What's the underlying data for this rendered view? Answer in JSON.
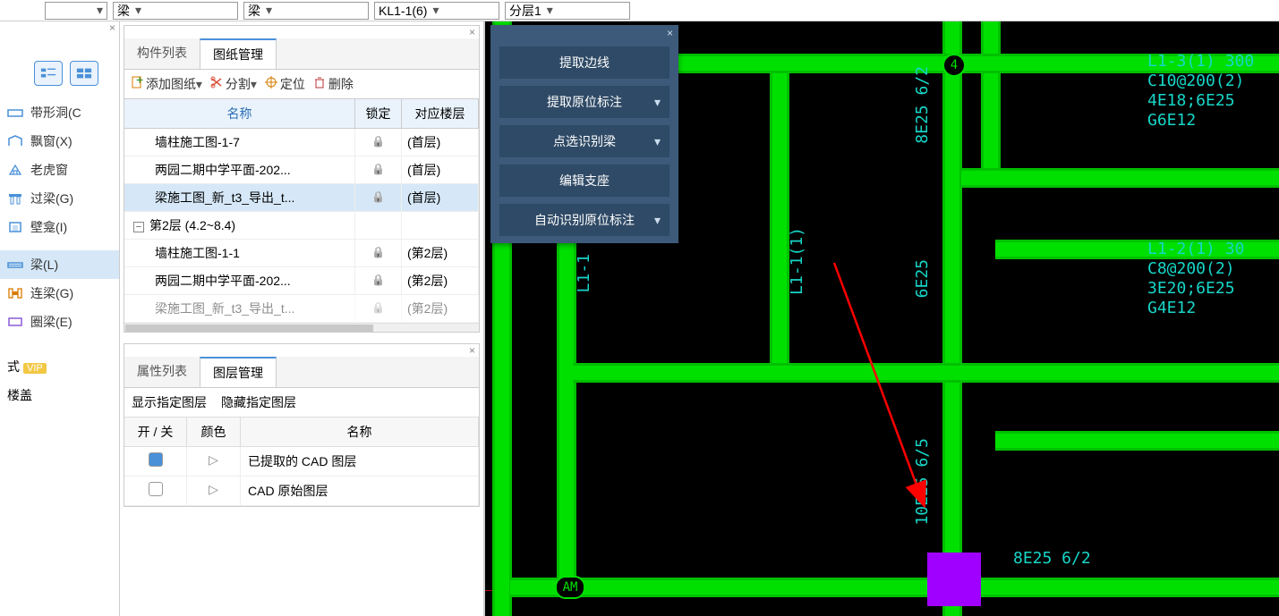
{
  "topbar": {
    "dd1": "",
    "dd2": "梁",
    "dd3": "梁",
    "dd4": "KL1-1(6)",
    "dd5": "分层1"
  },
  "left": {
    "items": [
      {
        "icon": "strip-hole",
        "label": "带形洞(C"
      },
      {
        "icon": "bay-window",
        "label": "飘窗(X)"
      },
      {
        "icon": "dormer",
        "label": "老虎窗"
      },
      {
        "icon": "lintel",
        "label": "过梁(G)"
      },
      {
        "icon": "niche",
        "label": "壁龛(I)"
      }
    ],
    "items2": [
      {
        "icon": "beam",
        "label": "梁(L)",
        "selected": true
      },
      {
        "icon": "coupling",
        "label": "连梁(G)"
      },
      {
        "icon": "ring",
        "label": "圈梁(E)"
      }
    ],
    "bottom": {
      "row1": "式",
      "vip": "VIP",
      "row2": "楼盖"
    }
  },
  "drawings_panel": {
    "tabs": {
      "t1": "构件列表",
      "t2": "图纸管理"
    },
    "toolbar": {
      "add": "添加图纸",
      "split": "分割",
      "locate": "定位",
      "del": "删除"
    },
    "headers": {
      "name": "名称",
      "lock": "锁定",
      "floor": "对应楼层"
    },
    "rows": [
      {
        "name": "墙柱施工图-1-7",
        "floor": "(首层)"
      },
      {
        "name": "两园二期中学平面-202...",
        "floor": "(首层)"
      },
      {
        "name": "梁施工图_新_t3_导出_t...",
        "floor": "(首层)",
        "selected": true
      },
      {
        "name": "第2层 (4.2~8.4)",
        "group": true,
        "floor": ""
      },
      {
        "name": "墙柱施工图-1-1",
        "floor": "(第2层)"
      },
      {
        "name": "两园二期中学平面-202...",
        "floor": "(第2层)"
      },
      {
        "name": "梁施工图_新_t3_导出_t...",
        "floor": "(第2层)",
        "dim": true
      }
    ]
  },
  "layers_panel": {
    "tabs": {
      "t1": "属性列表",
      "t2": "图层管理"
    },
    "sub": {
      "show": "显示指定图层",
      "hide": "隐藏指定图层"
    },
    "headers": {
      "onoff": "开 / 关",
      "color": "颜色",
      "name": "名称"
    },
    "rows": [
      {
        "checked": true,
        "name": "已提取的 CAD 图层"
      },
      {
        "checked": false,
        "name": "CAD 原始图层"
      }
    ]
  },
  "float_panel": {
    "b1": "提取边线",
    "b2": "提取原位标注",
    "b3": "点选识别梁",
    "b4": "编辑支座",
    "b5": "自动识别原位标注"
  },
  "cad": {
    "bubble4": "4",
    "bubbleAM": "AM",
    "l1_1": "L1-1(1)",
    "t_8e25a": "8E25 6/2",
    "t_6e25": "6E25",
    "t_10e25": "10E25 6/5",
    "t_8e25b": "8E25 6/2",
    "blk1_l1": "L1-3(1) 300",
    "blk1_c": "C10@200(2)",
    "blk1_e": "4E18;6E25",
    "blk1_g": "G6E12",
    "blk2_l": "L1-2(1) 30",
    "blk2_c": "C8@200(2)",
    "blk2_e": "3E20;6E25",
    "blk2_g": "G4E12"
  }
}
